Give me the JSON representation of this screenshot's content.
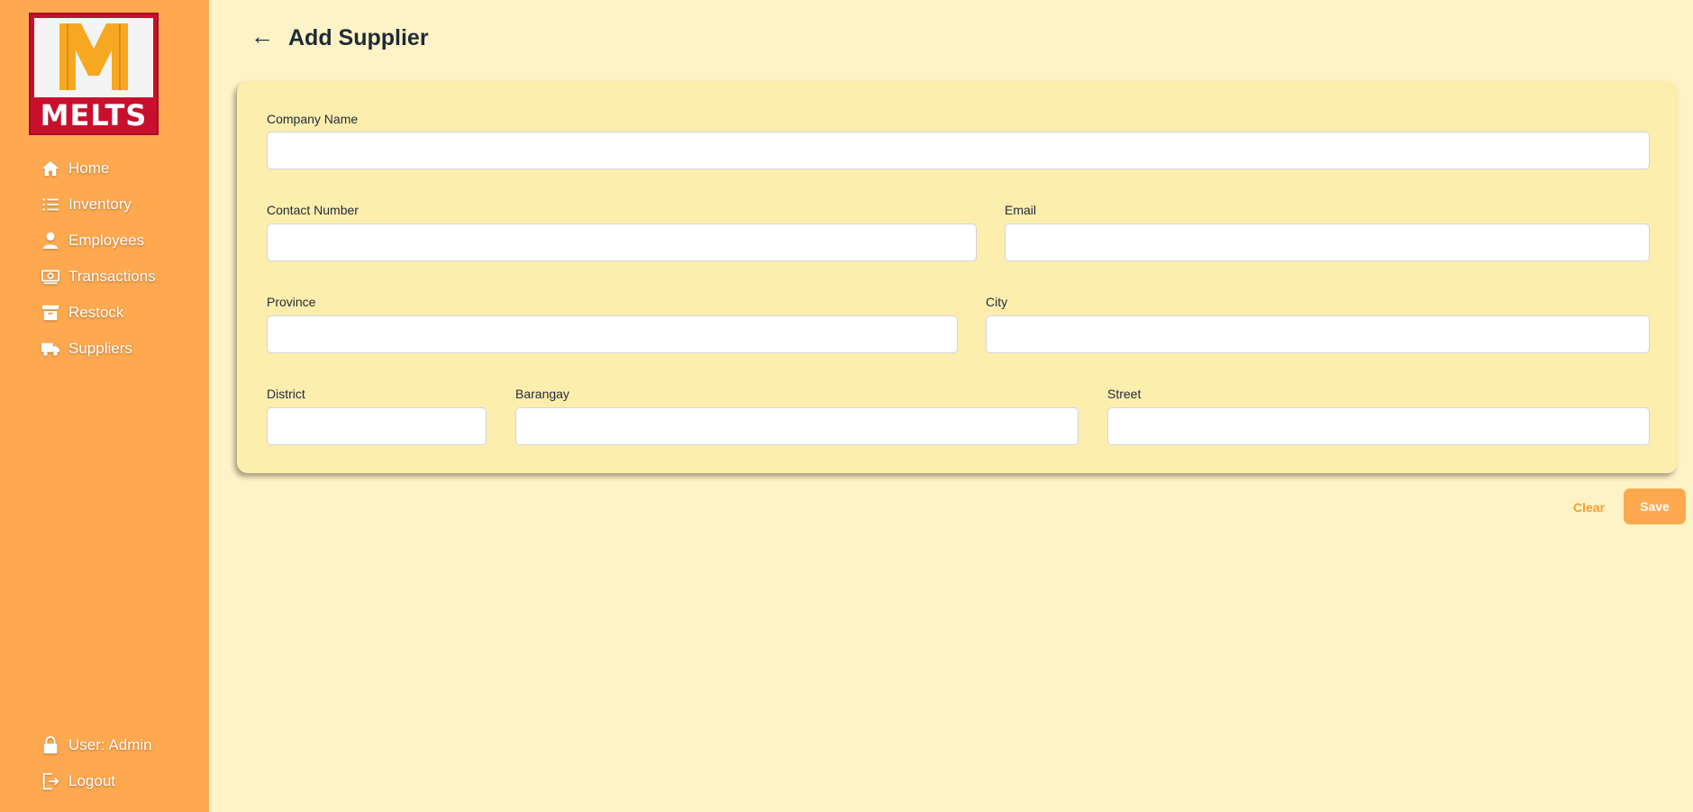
{
  "brand": {
    "logo_text": "MELTS",
    "logo_letter": "M"
  },
  "sidebar": {
    "items": [
      {
        "label": "Home",
        "icon": "home-icon"
      },
      {
        "label": "Inventory",
        "icon": "list-icon"
      },
      {
        "label": "Employees",
        "icon": "person-icon"
      },
      {
        "label": "Transactions",
        "icon": "cash-icon"
      },
      {
        "label": "Restock",
        "icon": "archive-icon"
      },
      {
        "label": "Suppliers",
        "icon": "truck-icon"
      }
    ],
    "user_label": "User: Admin",
    "logout_label": "Logout"
  },
  "header": {
    "back_arrow": "←",
    "title": "Add Supplier"
  },
  "form": {
    "company_name": {
      "label": "Company Name",
      "value": ""
    },
    "contact_number": {
      "label": "Contact Number",
      "value": ""
    },
    "email": {
      "label": "Email",
      "value": ""
    },
    "province": {
      "label": "Province",
      "value": ""
    },
    "city": {
      "label": "City",
      "value": ""
    },
    "district": {
      "label": "District",
      "value": ""
    },
    "barangay": {
      "label": "Barangay",
      "value": ""
    },
    "street": {
      "label": "Street",
      "value": ""
    }
  },
  "actions": {
    "clear_label": "Clear",
    "save_label": "Save"
  },
  "colors": {
    "sidebar": "#fea94f",
    "background": "#fef3c6",
    "card": "#feeeae",
    "logo_red": "#c8102e",
    "logo_yellow": "#f7a823",
    "accent": "#f59e33"
  }
}
